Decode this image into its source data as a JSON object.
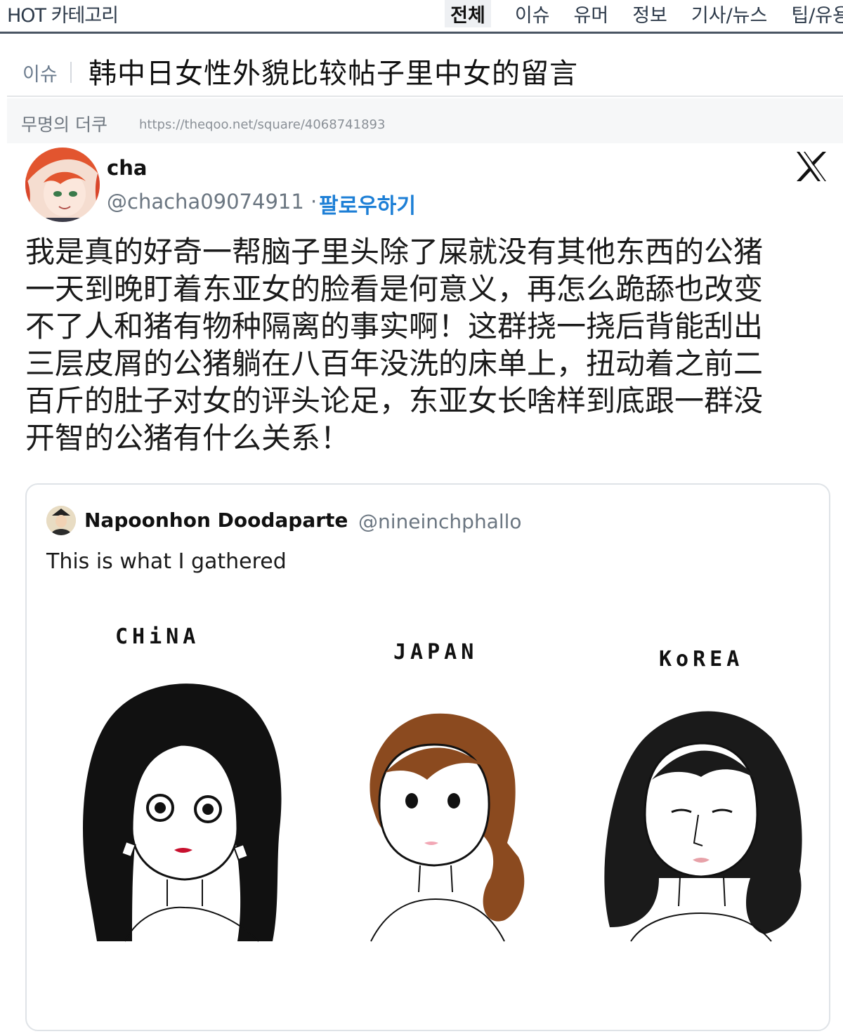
{
  "nav": {
    "brand": "HOT 카테고리",
    "tabs": [
      "전체",
      "이슈",
      "유머",
      "정보",
      "기사/뉴스",
      "팁/유용"
    ]
  },
  "post": {
    "category": "이슈",
    "title": "韩中日女性外貌比较帖子里中女的留言",
    "author": "무명의 더쿠",
    "url": "https://theqoo.net/square/4068741893"
  },
  "tweet": {
    "name": "cha",
    "handle": "@chacha09074911",
    "separator": "·",
    "follow_label": "팔로우하기",
    "body_lines": [
      "我是真的好奇一帮脑子里头除了屎就没有其他东西的公猪",
      "一天到晚盯着东亚女的脸看是何意义，再怎么跪舔也改变",
      "不了人和猪有物种隔离的事实啊！这群挠一挠后背能刮出",
      "三层皮屑的公猪躺在八百年没洗的床单上，扭动着之前二",
      "百斤的肚子对女的评头论足，东亚女长啥样到底跟一群没",
      "开智的公猪有什么关系！"
    ]
  },
  "quote": {
    "name": "Napoonhon Doodaparte",
    "handle": "@nineinchphallo",
    "text": "This is what I gathered",
    "labels": [
      "CHiNA",
      "JAPAN",
      "KoREA"
    ]
  }
}
